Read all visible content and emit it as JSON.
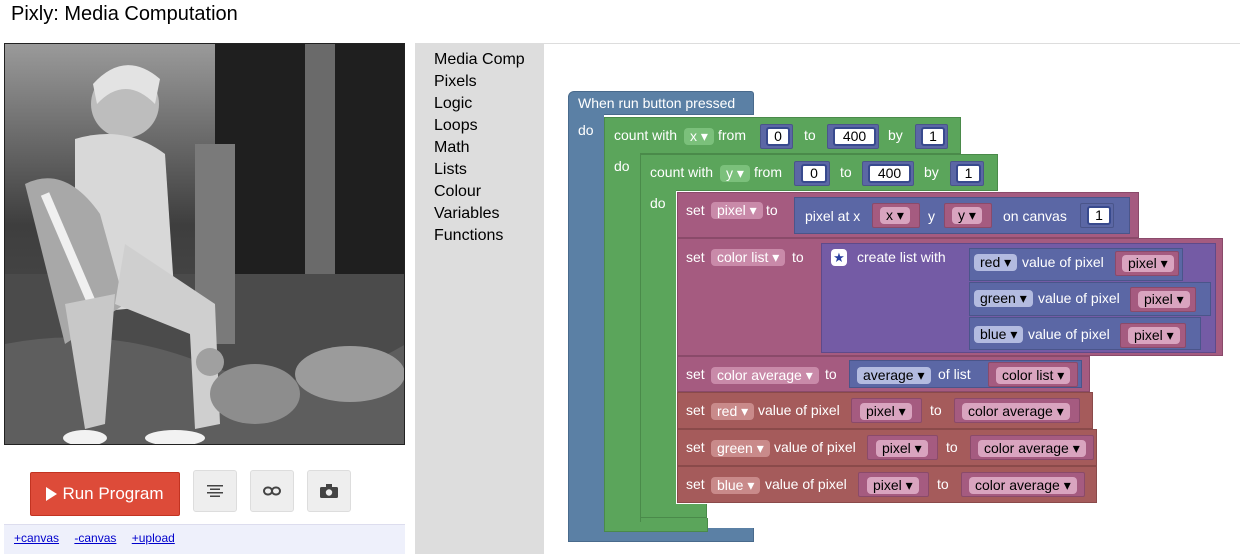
{
  "title": "Pixly: Media Computation",
  "controls": {
    "run_label": "Run Program",
    "links": [
      "+canvas",
      "-canvas",
      "+upload"
    ]
  },
  "toolbox": [
    "Media Comp",
    "Pixels",
    "Logic",
    "Loops",
    "Math",
    "Lists",
    "Colour",
    "Variables",
    "Functions"
  ],
  "blocks": {
    "event": "When run button pressed",
    "do": "do",
    "loop_x": {
      "count_with": "count with",
      "var": "x",
      "from": "from",
      "from_val": "0",
      "to": "to",
      "to_val": "400",
      "by": "by",
      "by_val": "1"
    },
    "loop_y": {
      "count_with": "count with",
      "var": "y",
      "from": "from",
      "from_val": "0",
      "to": "to",
      "to_val": "400",
      "by": "by",
      "by_val": "1"
    },
    "set_pixel": {
      "set": "set",
      "var": "pixel",
      "to": "to",
      "pixel_at": "pixel at x",
      "x": "x",
      "y_label": "y",
      "y": "y",
      "on_canvas": "on canvas",
      "canvas_val": "1"
    },
    "set_colorlist": {
      "set": "set",
      "var": "color list",
      "to": "to",
      "create": "create list with",
      "items": [
        {
          "channel": "red",
          "label": "value of pixel",
          "var": "pixel"
        },
        {
          "channel": "green",
          "label": "value of pixel",
          "var": "pixel"
        },
        {
          "channel": "blue",
          "label": "value of pixel",
          "var": "pixel"
        }
      ]
    },
    "set_avg": {
      "set": "set",
      "var": "color average",
      "to": "to",
      "op": "average",
      "of_list": "of list",
      "list": "color list"
    },
    "set_channels": [
      {
        "set": "set",
        "channel": "red",
        "label": "value of pixel",
        "var": "pixel",
        "to": "to",
        "val": "color average"
      },
      {
        "set": "set",
        "channel": "green",
        "label": "value of pixel",
        "var": "pixel",
        "to": "to",
        "val": "color average"
      },
      {
        "set": "set",
        "channel": "blue",
        "label": "value of pixel",
        "var": "pixel",
        "to": "to",
        "val": "color average"
      }
    ]
  },
  "colors": {
    "event": "#5b80a5",
    "loop": "#5ba55b",
    "set": "#a55b80",
    "pixel": "#5b67a5",
    "list": "#745ba5",
    "channel": "#a55b5b",
    "run": "#dd4b39"
  }
}
